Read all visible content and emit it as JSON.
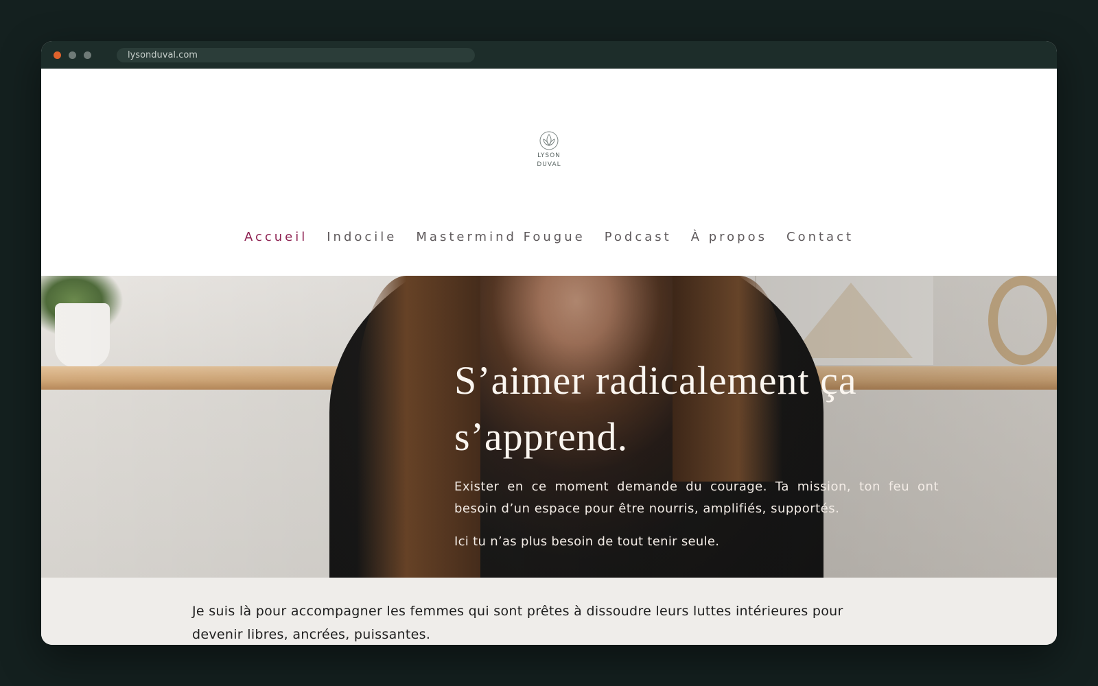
{
  "browser": {
    "url": "lysonduval.com"
  },
  "logo": {
    "line1": "LYSON",
    "line2": "DUVAL"
  },
  "nav": {
    "items": [
      {
        "label": "Accueil",
        "active": true
      },
      {
        "label": "Indocile",
        "active": false
      },
      {
        "label": "Mastermind Fougue",
        "active": false
      },
      {
        "label": "Podcast",
        "active": false
      },
      {
        "label": "À propos",
        "active": false
      },
      {
        "label": "Contact",
        "active": false
      }
    ]
  },
  "hero": {
    "title_line1": "S’aimer radicalement ça",
    "title_line2": "s’apprend.",
    "paragraph": "Exister en ce moment demande du courage. Ta mission, ton feu ont besoin d’un espace pour être nourris, amplifiés, supportés.",
    "paragraph2": "Ici tu n’as plus besoin de tout tenir seule."
  },
  "intro": {
    "text": "Je suis là pour accompagner les femmes qui sont prêtes à dissoudre leurs luttes intérieures pour devenir libres, ancrées, puissantes."
  },
  "colors": {
    "accent": "#8e2252",
    "nav_text": "#5f5a5c",
    "page_bg": "#14201f",
    "intro_bg": "#efedea"
  }
}
